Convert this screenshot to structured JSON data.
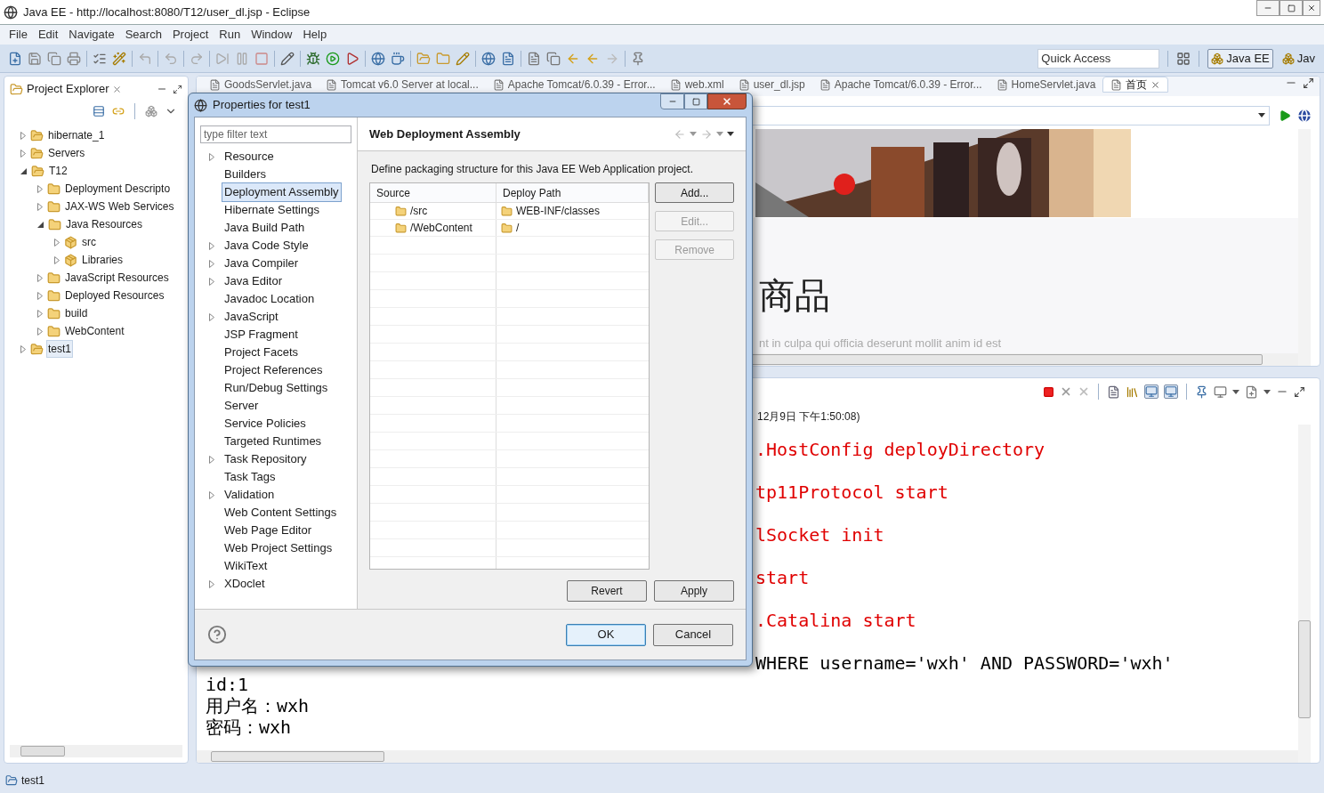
{
  "window": {
    "title": "Java EE - http://localhost:8080/T12/user_dl.jsp - Eclipse"
  },
  "menu": [
    "File",
    "Edit",
    "Navigate",
    "Search",
    "Project",
    "Run",
    "Window",
    "Help"
  ],
  "toolbar": {
    "quick_access": {
      "placeholder": "Quick Access"
    },
    "perspectives": [
      {
        "label": "Java EE",
        "selected": true
      },
      {
        "label": "Jav",
        "selected": false
      }
    ]
  },
  "project_explorer": {
    "title": "Project Explorer",
    "items": [
      {
        "label": "hibernate_1",
        "expanded": false,
        "selected": false
      },
      {
        "label": "Servers",
        "expanded": false,
        "selected": false
      },
      {
        "label": "T12",
        "expanded": true,
        "selected": false,
        "children": [
          {
            "label": "Deployment Descripto",
            "expanded": false,
            "selected": false
          },
          {
            "label": "JAX-WS Web Services",
            "expanded": false,
            "selected": false
          },
          {
            "label": "Java Resources",
            "expanded": true,
            "selected": false,
            "children": [
              {
                "label": "src",
                "expanded": false,
                "selected": false
              },
              {
                "label": "Libraries",
                "expanded": false,
                "selected": false
              }
            ]
          },
          {
            "label": "JavaScript Resources",
            "expanded": false,
            "selected": false
          },
          {
            "label": "Deployed Resources",
            "expanded": false,
            "selected": false
          },
          {
            "label": "build",
            "expanded": false,
            "selected": false
          },
          {
            "label": "WebContent",
            "expanded": false,
            "selected": false
          }
        ]
      },
      {
        "label": "test1",
        "expanded": false,
        "selected": true
      }
    ]
  },
  "editor": {
    "tabs": [
      {
        "label": "GoodsServlet.java",
        "selected": false
      },
      {
        "label": "Tomcat v6.0 Server at local...",
        "selected": false
      },
      {
        "label": "Apache Tomcat/6.0.39 - Error...",
        "selected": false
      },
      {
        "label": "web.xml",
        "selected": false
      },
      {
        "label": "user_dl.jsp",
        "selected": false
      },
      {
        "label": "Apache Tomcat/6.0.39 - Error...",
        "selected": false
      },
      {
        "label": "HomeServlet.java",
        "selected": false
      },
      {
        "label": "首页",
        "selected": true
      }
    ],
    "heading": "商品",
    "text": "nt in culpa qui officia deserunt mollit anim id est"
  },
  "console": {
    "header": "12月9日 下午1:50:08)",
    "lines_behind_dialog": [
      {
        "text": ".HostConfig deployDirectory",
        "kind": "err"
      },
      {
        "text": "tp11Protocol start",
        "kind": "err"
      },
      {
        "text": "lSocket init",
        "kind": "err"
      },
      {
        "text": "start",
        "kind": "err"
      },
      {
        "text": ".Catalina start",
        "kind": "err"
      },
      {
        "text": "WHERE username='wxh' AND PASSWORD='wxh'",
        "kind": "out"
      }
    ],
    "lines": [
      {
        "text": "id:1"
      },
      {
        "text": "用户名：wxh"
      },
      {
        "text": "密码：wxh"
      }
    ]
  },
  "status_bar": {
    "text": "test1"
  },
  "dialog": {
    "title": "Properties for test1",
    "filter": {
      "placeholder": "type filter text"
    },
    "pages": [
      {
        "label": "Resource",
        "expandable": true,
        "selected": false
      },
      {
        "label": "Builders",
        "expandable": false,
        "selected": false
      },
      {
        "label": "Deployment Assembly",
        "expandable": false,
        "selected": true
      },
      {
        "label": "Hibernate Settings",
        "expandable": false,
        "selected": false
      },
      {
        "label": "Java Build Path",
        "expandable": false,
        "selected": false
      },
      {
        "label": "Java Code Style",
        "expandable": true,
        "selected": false
      },
      {
        "label": "Java Compiler",
        "expandable": true,
        "selected": false
      },
      {
        "label": "Java Editor",
        "expandable": true,
        "selected": false
      },
      {
        "label": "Javadoc Location",
        "expandable": false,
        "selected": false
      },
      {
        "label": "JavaScript",
        "expandable": true,
        "selected": false
      },
      {
        "label": "JSP Fragment",
        "expandable": false,
        "selected": false
      },
      {
        "label": "Project Facets",
        "expandable": false,
        "selected": false
      },
      {
        "label": "Project References",
        "expandable": false,
        "selected": false
      },
      {
        "label": "Run/Debug Settings",
        "expandable": false,
        "selected": false
      },
      {
        "label": "Server",
        "expandable": false,
        "selected": false
      },
      {
        "label": "Service Policies",
        "expandable": false,
        "selected": false
      },
      {
        "label": "Targeted Runtimes",
        "expandable": false,
        "selected": false
      },
      {
        "label": "Task Repository",
        "expandable": true,
        "selected": false
      },
      {
        "label": "Task Tags",
        "expandable": false,
        "selected": false
      },
      {
        "label": "Validation",
        "expandable": true,
        "selected": false
      },
      {
        "label": "Web Content Settings",
        "expandable": false,
        "selected": false
      },
      {
        "label": "Web Page Editor",
        "expandable": false,
        "selected": false
      },
      {
        "label": "Web Project Settings",
        "expandable": false,
        "selected": false
      },
      {
        "label": "WikiText",
        "expandable": false,
        "selected": false
      },
      {
        "label": "XDoclet",
        "expandable": true,
        "selected": false
      }
    ],
    "page": {
      "title": "Web Deployment Assembly",
      "description": "Define packaging structure for this Java EE Web Application project.",
      "columns": [
        "Source",
        "Deploy Path"
      ],
      "rows": [
        {
          "source": "/src",
          "deploy_path": "WEB-INF/classes"
        },
        {
          "source": "/WebContent",
          "deploy_path": "/"
        }
      ],
      "side_buttons": [
        {
          "label": "Add...",
          "disabled": false
        },
        {
          "label": "Edit...",
          "disabled": true
        },
        {
          "label": "Remove",
          "disabled": true
        }
      ],
      "buttons": [
        "Revert",
        "Apply"
      ]
    },
    "buttons": [
      {
        "label": "OK",
        "default": true
      },
      {
        "label": "Cancel",
        "default": false
      }
    ]
  }
}
